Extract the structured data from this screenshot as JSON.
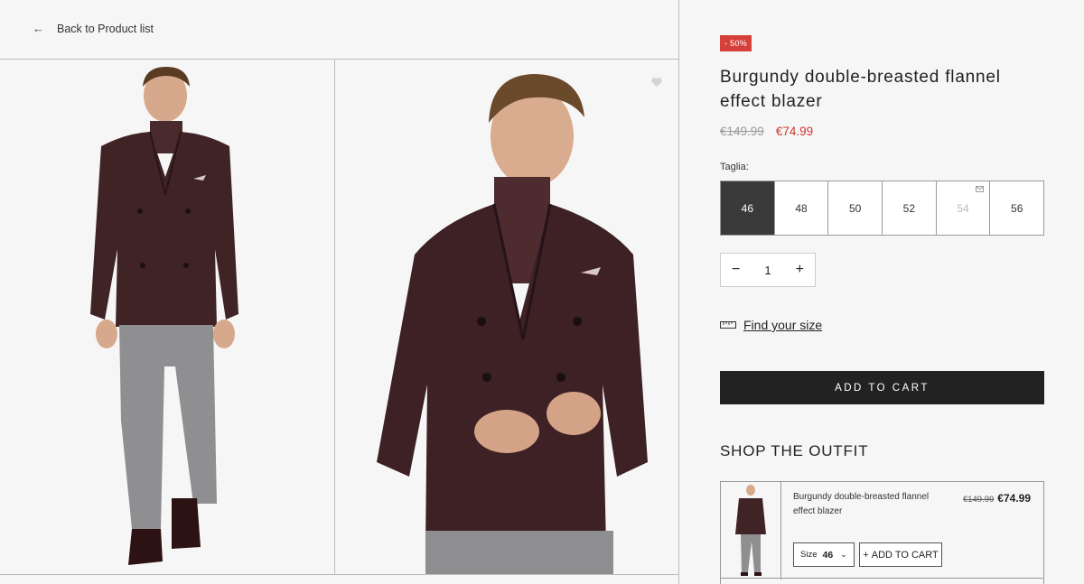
{
  "nav": {
    "back_label": "Back to Product list",
    "back_icon": "arrow-left-icon"
  },
  "gallery": {
    "images": [
      {
        "alt": "full-length model in burgundy double-breasted blazer and grey trousers"
      },
      {
        "alt": "close-up model in burgundy double-breasted blazer with turtleneck"
      }
    ],
    "favorite_icon": "heart-icon"
  },
  "product": {
    "discount_badge": "- 50%",
    "title": "Burgundy double-breasted flannel effect blazer",
    "old_price": "€149.99",
    "new_price": "€74.99",
    "size_label": "Taglia:",
    "sizes": [
      "46",
      "48",
      "50",
      "52",
      "54",
      "56"
    ],
    "selected_size": "46",
    "unavailable_sizes": [
      "54"
    ],
    "quantity": "1",
    "find_size": "Find your size",
    "add_to_cart": "ADD TO CART"
  },
  "outfit": {
    "heading": "SHOP THE OUTFIT",
    "items": [
      {
        "name": "Burgundy double-breasted flannel effect blazer",
        "old_price": "€149.99",
        "new_price": "€74.99",
        "size_label": "Size",
        "size_value": "46",
        "add_label": "ADD TO CART"
      }
    ]
  },
  "colors": {
    "accent_red": "#d6403a",
    "price_red": "#d0362f",
    "button_dark": "#222222",
    "selected_size": "#3a3a3a"
  }
}
